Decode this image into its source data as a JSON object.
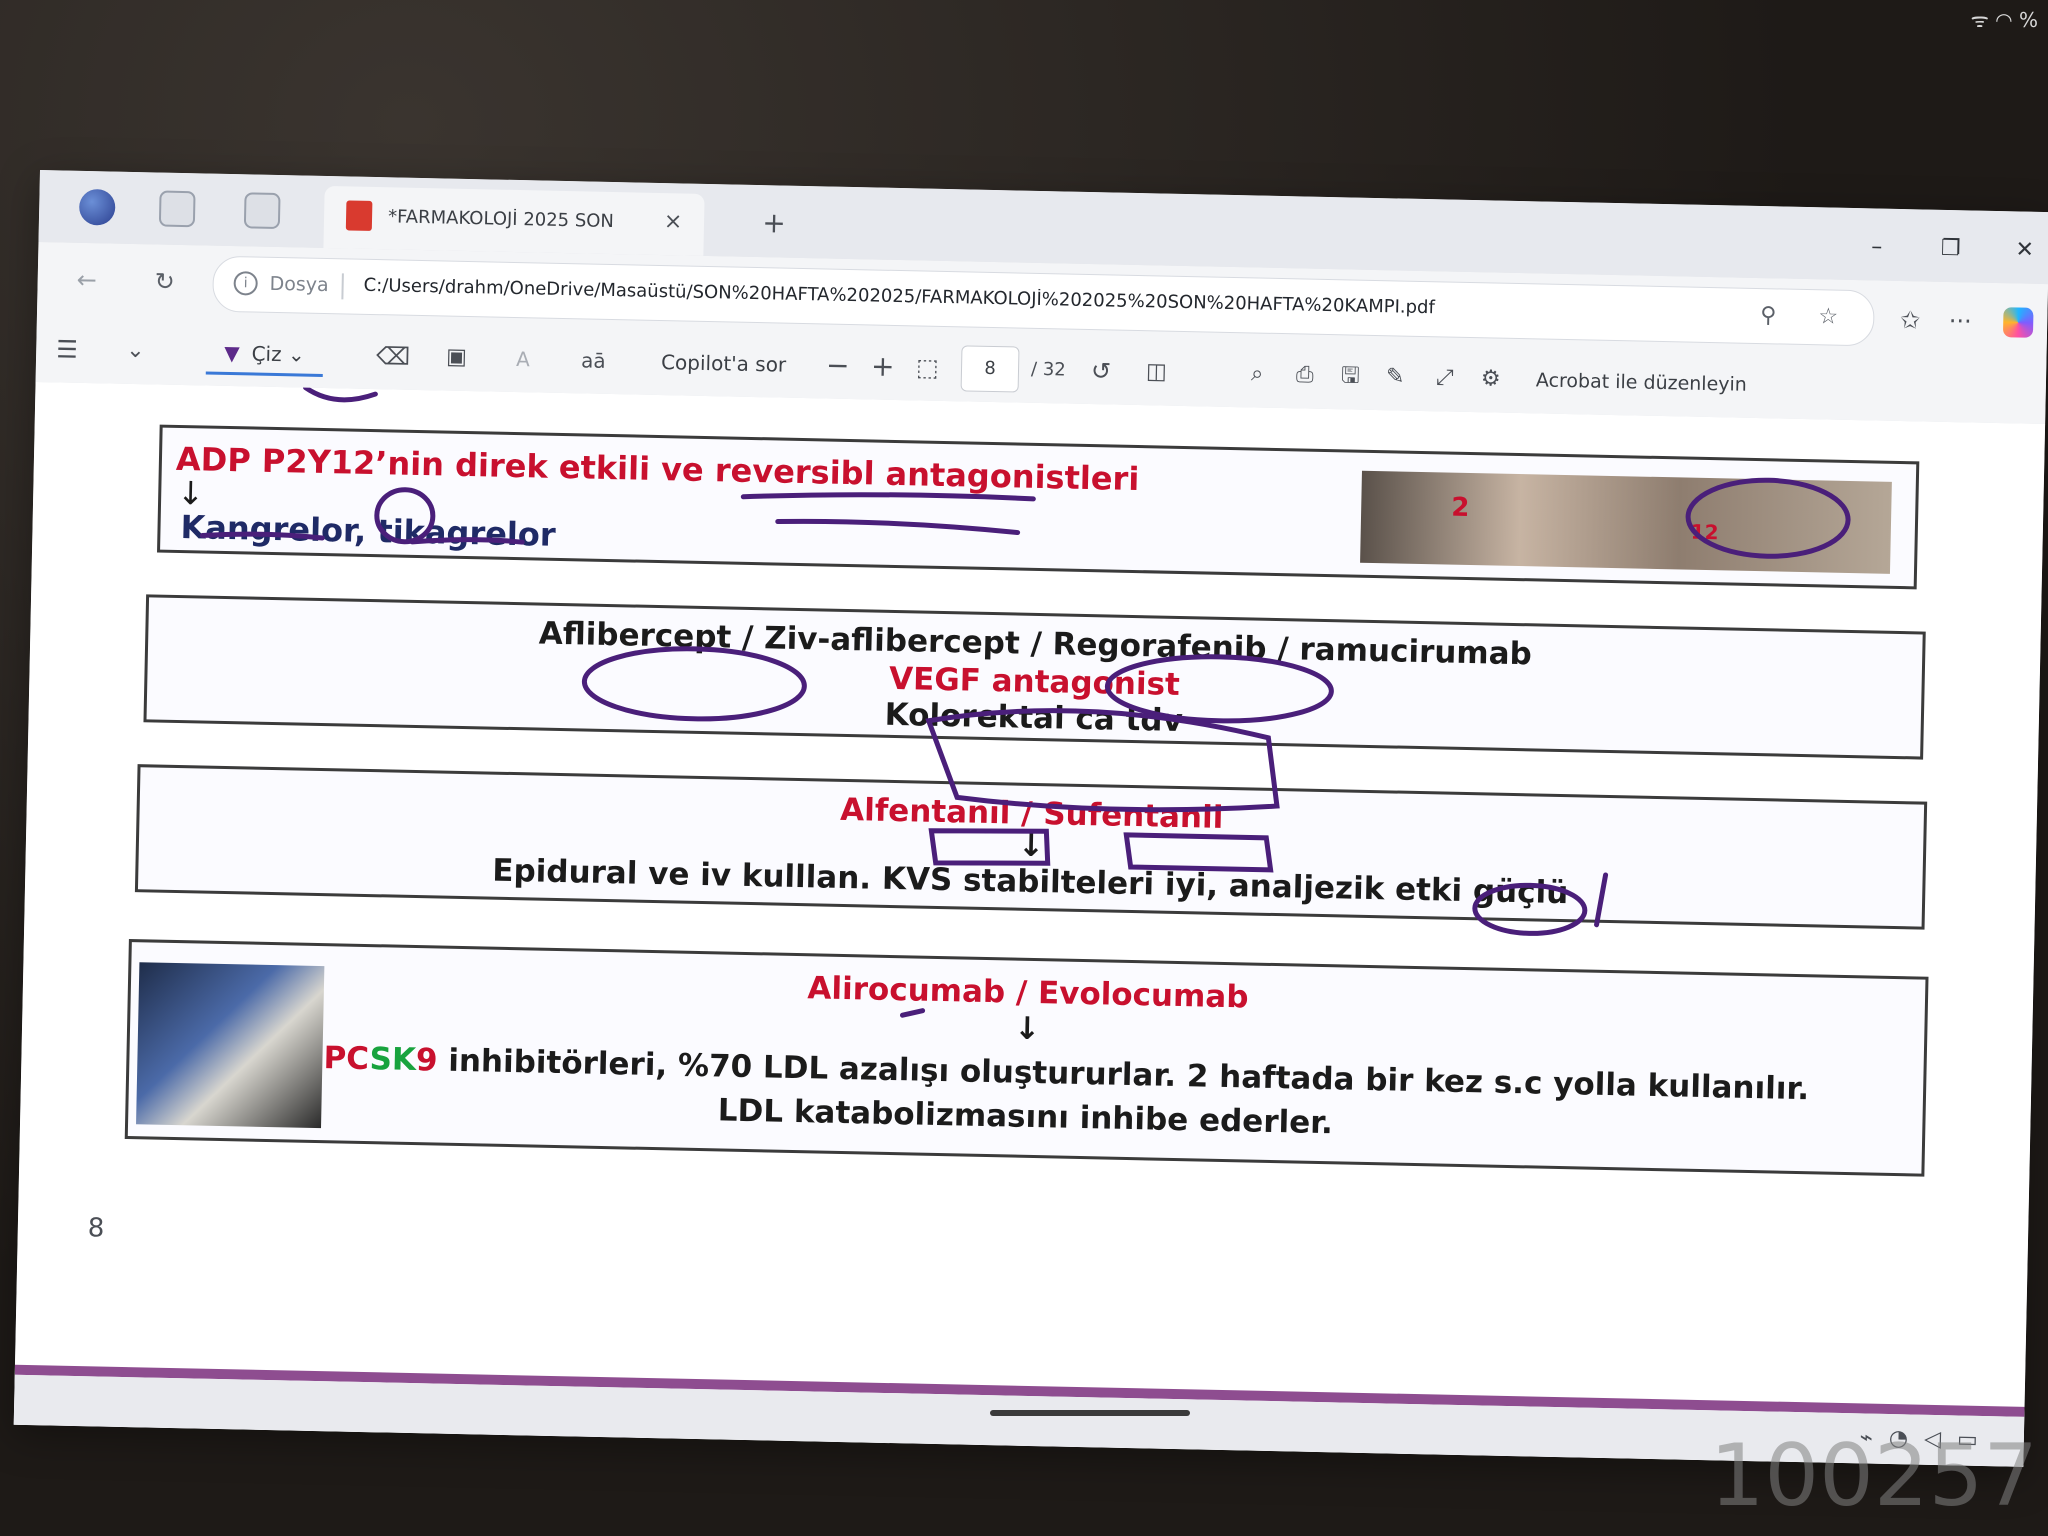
{
  "status": {
    "corner": "ᯤ ◠ %"
  },
  "browser": {
    "tab_title": "*FARMAKOLOJİ 2025 SON",
    "tab_close": "×",
    "new_tab": "+",
    "window_controls": {
      "minimize": "–",
      "restore": "❐",
      "close": "✕"
    },
    "site_label": "Dosya",
    "url": "C:/Users/drahm/OneDrive/Masaüstü/SON%20HAFTA%202025/FARMAKOLOJİ%202025%20SON%20HAFTA%20KAMPI.pdf"
  },
  "pdf_toolbar": {
    "draw_label": "Çiz",
    "copilot_label": "Copilot'a sor",
    "page_current": "8",
    "page_total": "/ 32",
    "acrobat_label": "Acrobat ile düzenleyin"
  },
  "slides": {
    "box1": {
      "title_red": "ADP P2Y12’nin direk etkili ve reversibl antagonistleri",
      "arrow": "↓",
      "drugs": "Kangrelor, tikagrelor",
      "img_label_2": "2",
      "img_label_12": "12"
    },
    "box2": {
      "drugs": "Aflibercept / Ziv-aflibercept / Regorafenib / ramucirumab",
      "class_label": "VEGF antagonist",
      "indication": "Kolorektal ca tdv"
    },
    "box3": {
      "drugs": "Alfentanil / Sufentanil",
      "arrow": "↓",
      "note": "Epidural ve iv kulllan. KVS stabilteleri iyi, analjezik etki güçlü"
    },
    "box4": {
      "drugs": "Alirocumab / Evolocumab",
      "arrow": "↓",
      "pcsk_p": "PC",
      "pcsk_sk": "SK",
      "pcsk_9": "9",
      "line1_rest": " inhibitörleri, %70 LDL azalışı oluştururlar. 2 haftada bir kez s.c yolla kullanılır.",
      "line2": "LDL katabolizmasını inhibe ederler."
    },
    "page_number": "8"
  },
  "watermark": "100257"
}
